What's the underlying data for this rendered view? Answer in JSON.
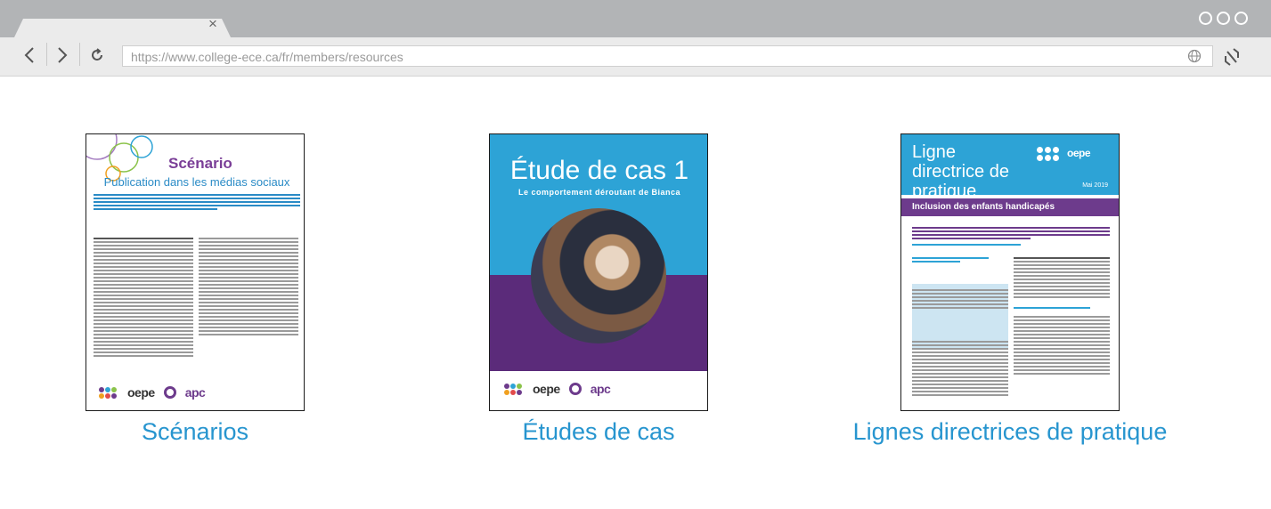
{
  "browser": {
    "tab_close": "×",
    "url": "https://www.college-ece.ca/fr/members/resources",
    "icons": [
      "back-icon",
      "forward-icon",
      "reload-icon",
      "globe-icon",
      "extension-icon",
      "close-icon"
    ]
  },
  "resources": [
    {
      "caption": "Scénarios",
      "doc_title": "Scénario",
      "doc_subtitle": "Publication dans les médias sociaux",
      "logo_left": "oepe",
      "logo_right": "apc"
    },
    {
      "caption": "Études de cas",
      "doc_title": "Étude de cas 1",
      "doc_subtitle": "Le comportement déroutant de Bianca",
      "logo_left": "oepe",
      "logo_right": "apc"
    },
    {
      "caption": "Lignes directrices de pratique",
      "doc_title": "Ligne directrice de pratique",
      "doc_date": "Mai 2019",
      "doc_subtitle": "Inclusion des enfants handicapés",
      "logo_left": "oepe"
    }
  ],
  "colors": {
    "caption": "#2795cf",
    "brand_blue": "#2da3d6",
    "brand_purple": "#6d3b8c",
    "chrome_dark": "#b2b4b6",
    "chrome_light": "#ebebeb"
  }
}
